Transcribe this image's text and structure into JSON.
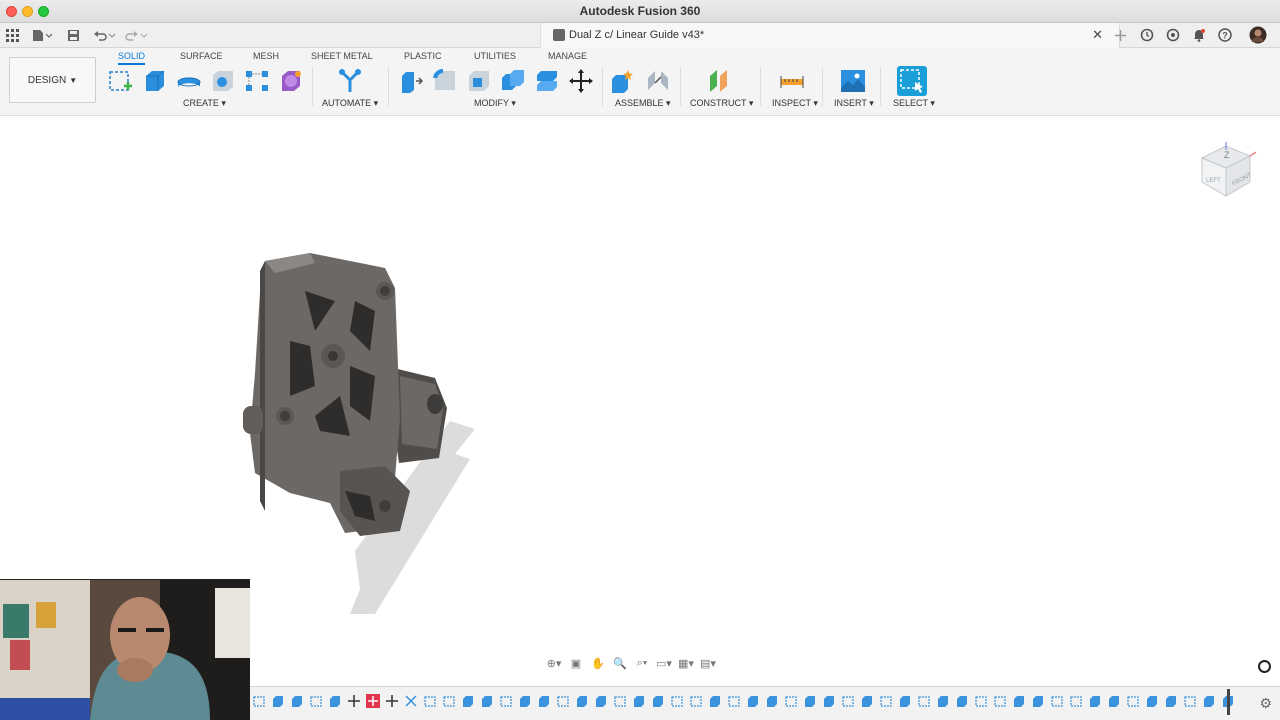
{
  "window": {
    "title": "Autodesk Fusion 360"
  },
  "document_tab": {
    "label": "Dual Z c/ Linear Guide v43*"
  },
  "workspace": {
    "label": "DESIGN"
  },
  "ribbon": {
    "tabs": [
      "SOLID",
      "SURFACE",
      "MESH",
      "SHEET METAL",
      "PLASTIC",
      "UTILITIES",
      "MANAGE"
    ],
    "active_tab": "SOLID",
    "groups": {
      "create": "CREATE",
      "automate": "AUTOMATE",
      "modify": "MODIFY",
      "assemble": "ASSEMBLE",
      "construct": "CONSTRUCT",
      "inspect": "INSPECT",
      "insert": "INSERT",
      "select": "SELECT"
    }
  },
  "viewcube": {
    "top_label": "Z",
    "left_label": "LEFT",
    "front_label": "FRONT"
  },
  "colors": {
    "accent": "#0a7ad6",
    "model_body": "#6b6865",
    "select_icon": "#1a9fd9"
  }
}
